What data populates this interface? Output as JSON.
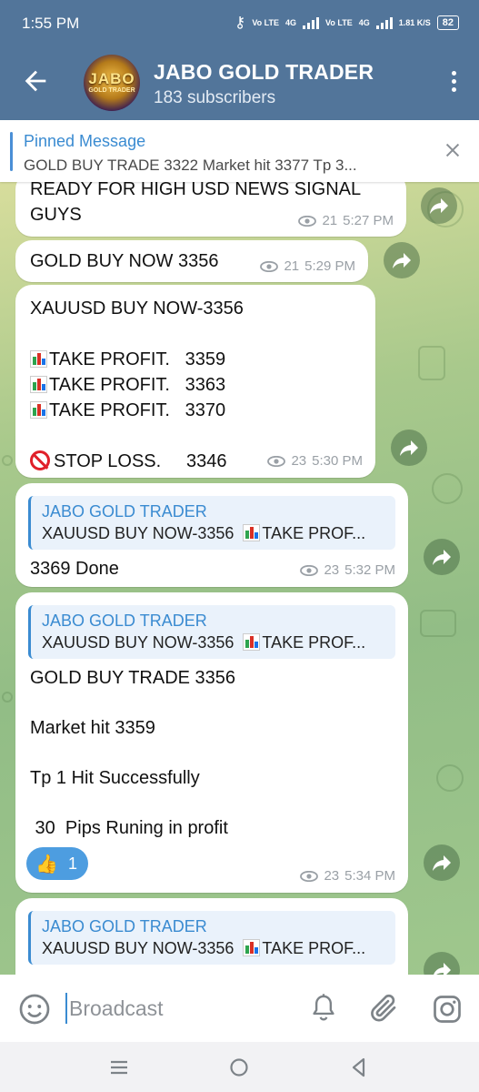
{
  "status_bar": {
    "time": "1:55 PM",
    "sim1": "Vo LTE",
    "net1": "4G",
    "sim2": "Vo LTE",
    "net2": "4G",
    "speed": "1.81 K/S",
    "battery": "82"
  },
  "header": {
    "title": "JABO GOLD TRADER",
    "subtitle": "183 subscribers",
    "avatar_text": "JABO",
    "avatar_subtext": "GOLD TRADER"
  },
  "pinned": {
    "title": "Pinned Message",
    "text": "GOLD BUY TRADE 3322  Market hit 3377  Tp 3..."
  },
  "messages": [
    {
      "lines": [
        "READY FOR HIGH USD NEWS SIGNAL",
        "GUYS"
      ],
      "views": "21",
      "time": "5:27 PM"
    },
    {
      "text": "GOLD BUY NOW 3356",
      "views": "21",
      "time": "5:29 PM"
    },
    {
      "line1": "XAUUSD BUY NOW-3356",
      "tp1": "TAKE PROFIT.   3359",
      "tp2": "TAKE PROFIT.   3363",
      "tp3": "TAKE PROFIT.   3370",
      "stop": "STOP LOSS.     3346",
      "views": "23",
      "time": "5:30 PM"
    },
    {
      "reply_name": "JABO GOLD TRADER",
      "reply_text": "XAUUSD BUY NOW-3356",
      "reply_text2": "TAKE PROF...",
      "text": "3369 Done",
      "views": "23",
      "time": "5:32 PM"
    },
    {
      "reply_name": "JABO GOLD TRADER",
      "reply_text": "XAUUSD BUY NOW-3356",
      "reply_text2": "TAKE PROF...",
      "l1": "GOLD BUY TRADE 3356",
      "l2": "Market hit 3359",
      "l3": "Tp 1 Hit Successfully",
      "l4": " 30  Pips Runing in profit",
      "reaction_count": "1",
      "views": "23",
      "time": "5:34 PM"
    },
    {
      "reply_name": "JABO GOLD TRADER",
      "reply_text": "XAUUSD BUY NOW-3356",
      "reply_text2": "TAKE PROF..."
    }
  ],
  "input": {
    "placeholder": "Broadcast"
  },
  "icons": {
    "back": "arrow-left-icon",
    "menu": "more-vert-icon",
    "share": "share-arrow-icon",
    "emoji": "smile-icon",
    "bell": "bell-icon",
    "clip": "paperclip-icon",
    "camera": "instagram-camera-icon"
  },
  "colors": {
    "header": "#52759a",
    "accent": "#3a8bd1",
    "reaction": "#4d9de0"
  }
}
